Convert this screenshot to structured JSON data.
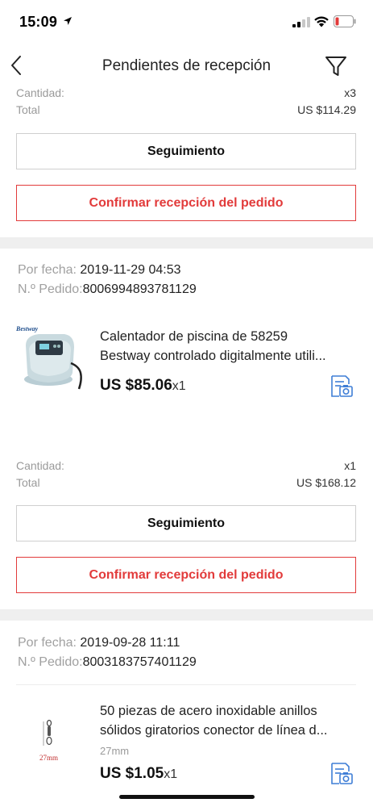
{
  "status_bar": {
    "time": "15:09"
  },
  "nav": {
    "title": "Pendientes de recepción"
  },
  "labels": {
    "cantidad": "Cantidad:",
    "total": "Total",
    "por_fecha": "Por fecha:",
    "n_pedido": "N.º Pedido:",
    "seguimiento": "Seguimiento",
    "confirmar": "Confirmar recepción del pedido"
  },
  "orders": [
    {
      "cantidad": "x3",
      "total": "US $114.29"
    },
    {
      "fecha": "2019-11-29 04:53",
      "pedido": "8006994893781129",
      "product": {
        "title_line1": "Calentador de piscina de 58259",
        "title_line2": "Bestway controlado digitalmente utili...",
        "brand_text": "Bestway",
        "price": "US $85.06",
        "qty": "x1"
      },
      "cantidad": "x1",
      "total": "US $168.12"
    },
    {
      "fecha": "2019-09-28 11:11",
      "pedido": "8003183757401129",
      "product": {
        "title_line1": "50 piezas de acero inoxidable anillos",
        "title_line2": "sólidos giratorios conector de línea d...",
        "variant": "27mm",
        "thumb_text": "27mm",
        "price": "US $1.05",
        "qty": "x1"
      }
    }
  ],
  "colors": {
    "accent_red": "#e23b3b",
    "icon_blue": "#3f7ed6",
    "divider": "#efefef",
    "muted_text": "#9a9a9a"
  },
  "icons": {
    "back": "chevron-left-icon",
    "filter": "filter-funnel-icon",
    "photo_review": "photo-review-icon",
    "location": "location-arrow-icon",
    "signal": "cellular-signal-icon",
    "wifi": "wifi-icon",
    "battery": "battery-low-icon"
  }
}
